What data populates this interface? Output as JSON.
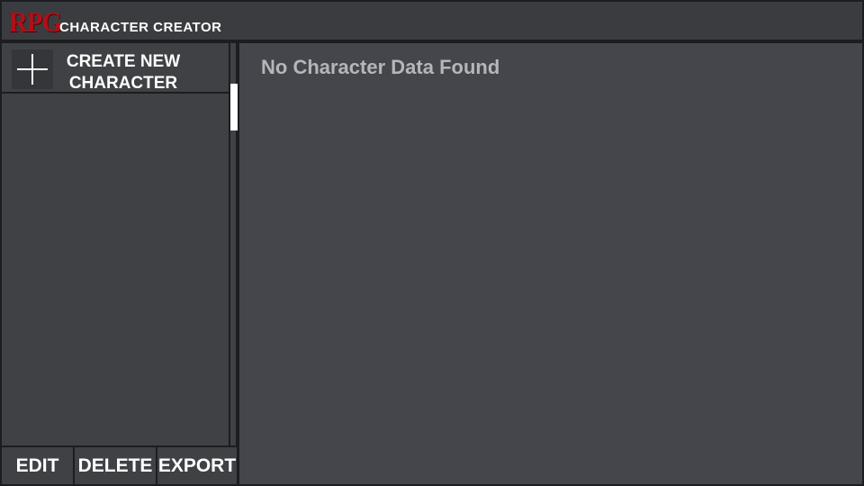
{
  "header": {
    "logo": "RPG",
    "title": "CHARACTER CREATOR"
  },
  "sidebar": {
    "create_label": "CREATE NEW CHARACTER",
    "characters": []
  },
  "main": {
    "empty_message": "No Character Data Found"
  },
  "actions": {
    "edit": "EDIT",
    "delete": "DELETE",
    "export": "EXPORT"
  },
  "colors": {
    "logo": "#b01018",
    "background": "#44464b"
  }
}
